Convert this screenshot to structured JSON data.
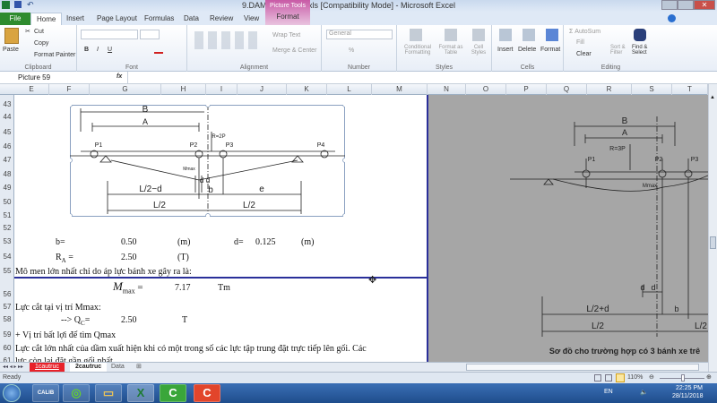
{
  "window": {
    "title": "9.DAMCAUTRUC.xls  [Compatibility Mode]  -  Microsoft Excel",
    "context_tab_group": "Picture Tools",
    "context_tab": "Format"
  },
  "tabs": [
    "File",
    "Home",
    "Insert",
    "Page Layout",
    "Formulas",
    "Data",
    "Review",
    "View"
  ],
  "ribbon": {
    "clipboard": {
      "paste": "Paste",
      "cut": "Cut",
      "copy": "Copy",
      "format_painter": "Format Painter",
      "label": "Clipboard"
    },
    "font": {
      "label": "Font",
      "bold": "B",
      "italic": "I",
      "underline": "U"
    },
    "alignment": {
      "wrap": "Wrap Text",
      "merge": "Merge & Center",
      "label": "Alignment"
    },
    "number": {
      "format": "General",
      "percent": "%",
      "label": "Number"
    },
    "styles": {
      "conditional": "Conditional Formatting",
      "table": "Format as Table",
      "cell": "Cell Styles",
      "label": "Styles"
    },
    "cells": {
      "insert": "Insert",
      "delete": "Delete",
      "format": "Format",
      "label": "Cells"
    },
    "editing": {
      "autosum": "AutoSum",
      "fill": "Fill",
      "clear": "Clear",
      "sort": "Sort & Filter",
      "find": "Find & Select",
      "label": "Editing"
    }
  },
  "formula_bar": {
    "name_box": "Picture 59",
    "fx": "fx",
    "value": ""
  },
  "columns": [
    "E",
    "F",
    "G",
    "H",
    "I",
    "J",
    "K",
    "L",
    "M",
    "N",
    "O",
    "P",
    "Q",
    "R",
    "S",
    "T"
  ],
  "rows": [
    "43",
    "44",
    "45",
    "46",
    "47",
    "48",
    "49",
    "50",
    "51",
    "52",
    "53",
    "54",
    "55",
    "56",
    "57",
    "58",
    "59",
    "60",
    "61"
  ],
  "diagram1": {
    "B": "B",
    "A": "A",
    "R": "R=2P",
    "P1": "P1",
    "P2": "P2",
    "P3": "P3",
    "P4": "P4",
    "mmax": "Mmax",
    "d1": "d",
    "d2": "d",
    "L2d": "L/2−d",
    "b": "b",
    "e": "e",
    "L2a": "L/2",
    "L2b": "L/2"
  },
  "diagram2": {
    "B": "B",
    "A": "A",
    "R": "R=3P",
    "P1": "P1",
    "P2": "P2",
    "P3": "P3",
    "mmax": "Mmax",
    "d1": "d",
    "d2": "d",
    "L2d": "L/2+d",
    "b": "b",
    "L2a": "L/2",
    "L2b": "L/2",
    "caption": "Sơ đồ cho trường hợp có 3 bánh xe trê"
  },
  "cells": {
    "b_label": "b=",
    "b_value": "0.50",
    "b_unit": "(m)",
    "d_label": "d=",
    "d_value": "0.125",
    "d_unit": "(m)",
    "ra_label": "R",
    "ra_sub": "A",
    "ra_eq": " =",
    "ra_value": "2.50",
    "ra_unit": "(T)",
    "r55": "Mô men lớn nhất chỉ do áp lực bánh xe gây ra là:",
    "mmax_label": "M",
    "mmax_sub": "max",
    "mmax_eq": " =",
    "mmax_value": "7.17",
    "mmax_unit": "Tm",
    "r57": "Lực cắt tại vị trí Mmax:",
    "qc_label": "--> Q",
    "qc_sub": "C",
    "qc_eq": "=",
    "qc_value": "2.50",
    "qc_unit": "T",
    "r59": "+ Vị trí bất lợi để tìm Qmax",
    "r60": "Lực cắt lớn nhất của dầm xuất hiện khi có một trong số các lực tập trung đặt trực tiếp lên gối. Các",
    "r61": "lực còn lại đặt gần gối nhất"
  },
  "sheets": [
    "1cautruc",
    "2cautruc",
    "Data"
  ],
  "status": {
    "ready": "Ready",
    "zoom": "110%"
  },
  "taskbar": {
    "lang": "EN",
    "time": "22:25 PM",
    "date": "28/11/2018"
  }
}
